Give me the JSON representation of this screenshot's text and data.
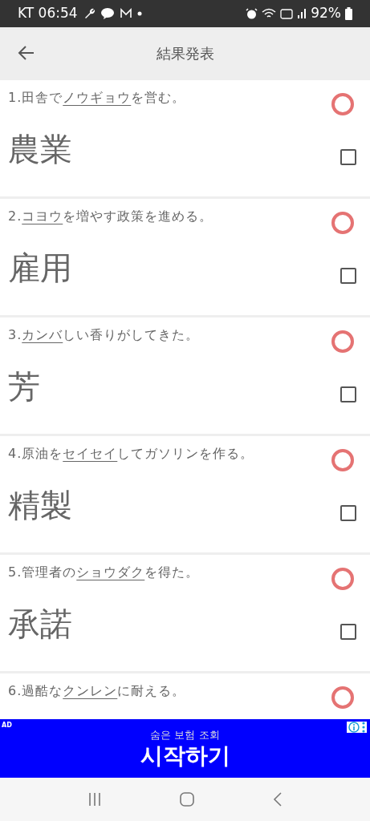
{
  "status_bar": {
    "carrier_time": "KT 06:54",
    "battery": "92%"
  },
  "app_bar": {
    "title": "結果発表"
  },
  "questions": [
    {
      "number": "1.",
      "before": "田舎で",
      "reading": "ノウギョウ",
      "after": "を営む。",
      "answer": "農業",
      "kind": "circle",
      "checked": false
    },
    {
      "number": "2.",
      "reading": "コヨウ",
      "after": "を増やす政策を進める。",
      "answer": "雇用",
      "kind": "circle",
      "checked": false
    },
    {
      "number": "3.",
      "reading": "カンバ",
      "after": "しい香りがしてきた。",
      "answer": "芳",
      "kind": "circle",
      "checked": false
    },
    {
      "number": "4.",
      "before": "原油を",
      "reading": "セイセイ",
      "after": "してガソリンを作る。",
      "answer": "精製",
      "kind": "circle",
      "checked": false
    },
    {
      "number": "5.",
      "before": "管理者の",
      "reading": "ショウダク",
      "after": "を得た。",
      "answer": "承諾",
      "kind": "circle",
      "checked": false
    },
    {
      "number": "6.",
      "before": "過酷な",
      "reading": "クンレン",
      "after": "に耐える。",
      "kind": "circle"
    }
  ],
  "ad": {
    "label": "AD",
    "subtitle": "숨은 보험 조회",
    "headline": "시작하기"
  }
}
